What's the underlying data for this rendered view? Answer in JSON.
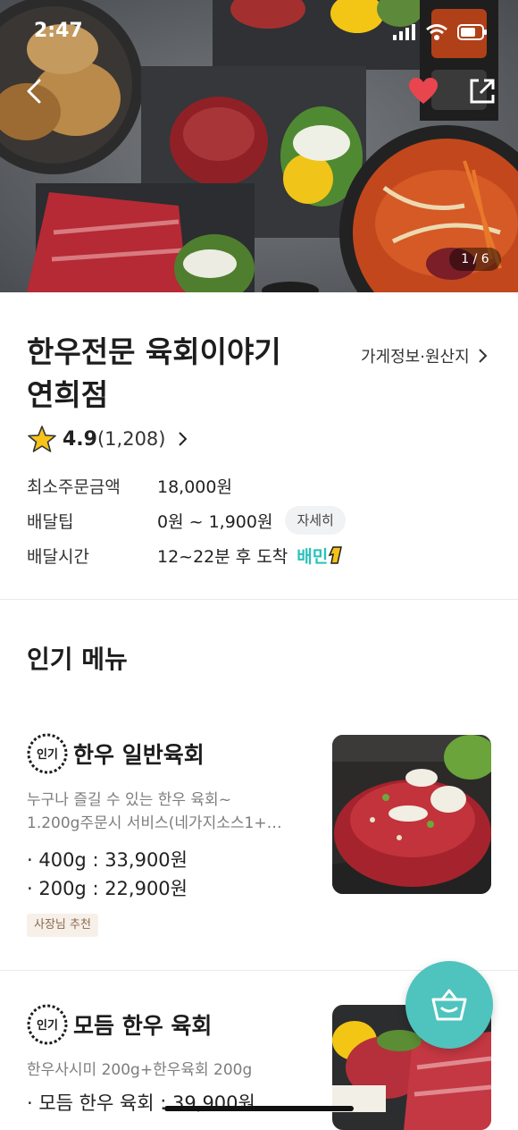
{
  "status_bar": {
    "time": "2:47"
  },
  "hero": {
    "page_indicator": "1 / 6"
  },
  "store": {
    "name_line1": "한우전문 육회이야기",
    "name_line2": "연희점",
    "info_link": "가게정보·원산지",
    "rating": "4.9",
    "review_count": "(1,208)"
  },
  "info": {
    "min_order_label": "최소주문금액",
    "min_order_value": "18,000원",
    "tip_label": "배달팁",
    "tip_value": "0원 ~ 1,900원",
    "tip_detail": "자세히",
    "time_label": "배달시간",
    "time_value": "12~22분 후 도착",
    "baemin": "배민"
  },
  "popular_section": {
    "title": "인기 메뉴"
  },
  "badge_text": "인기",
  "menu_items": [
    {
      "name": "한우 일반육회",
      "desc_line1": "누구나 즐길 수 있는 한우 육회~",
      "desc_line2": "1.200g주문시 서비스(네가지소스1+…",
      "option1": "· 400g : 33,900원",
      "option2": "· 200g : 22,900원",
      "tag": "사장님 추천"
    },
    {
      "name": "모듬 한우 육회",
      "desc_line1": "한우사시미 200g+한우육회 200g",
      "option1": "· 모듬 한우 육회 : 39,900원"
    }
  ],
  "colors": {
    "accent": "#2ac1bc",
    "cart": "#4fc3bd",
    "heart": "#e8454f"
  },
  "icons": [
    "back-arrow-icon",
    "heart-icon",
    "share-icon",
    "star-icon",
    "chevron-right-icon",
    "cart-basket-icon"
  ]
}
